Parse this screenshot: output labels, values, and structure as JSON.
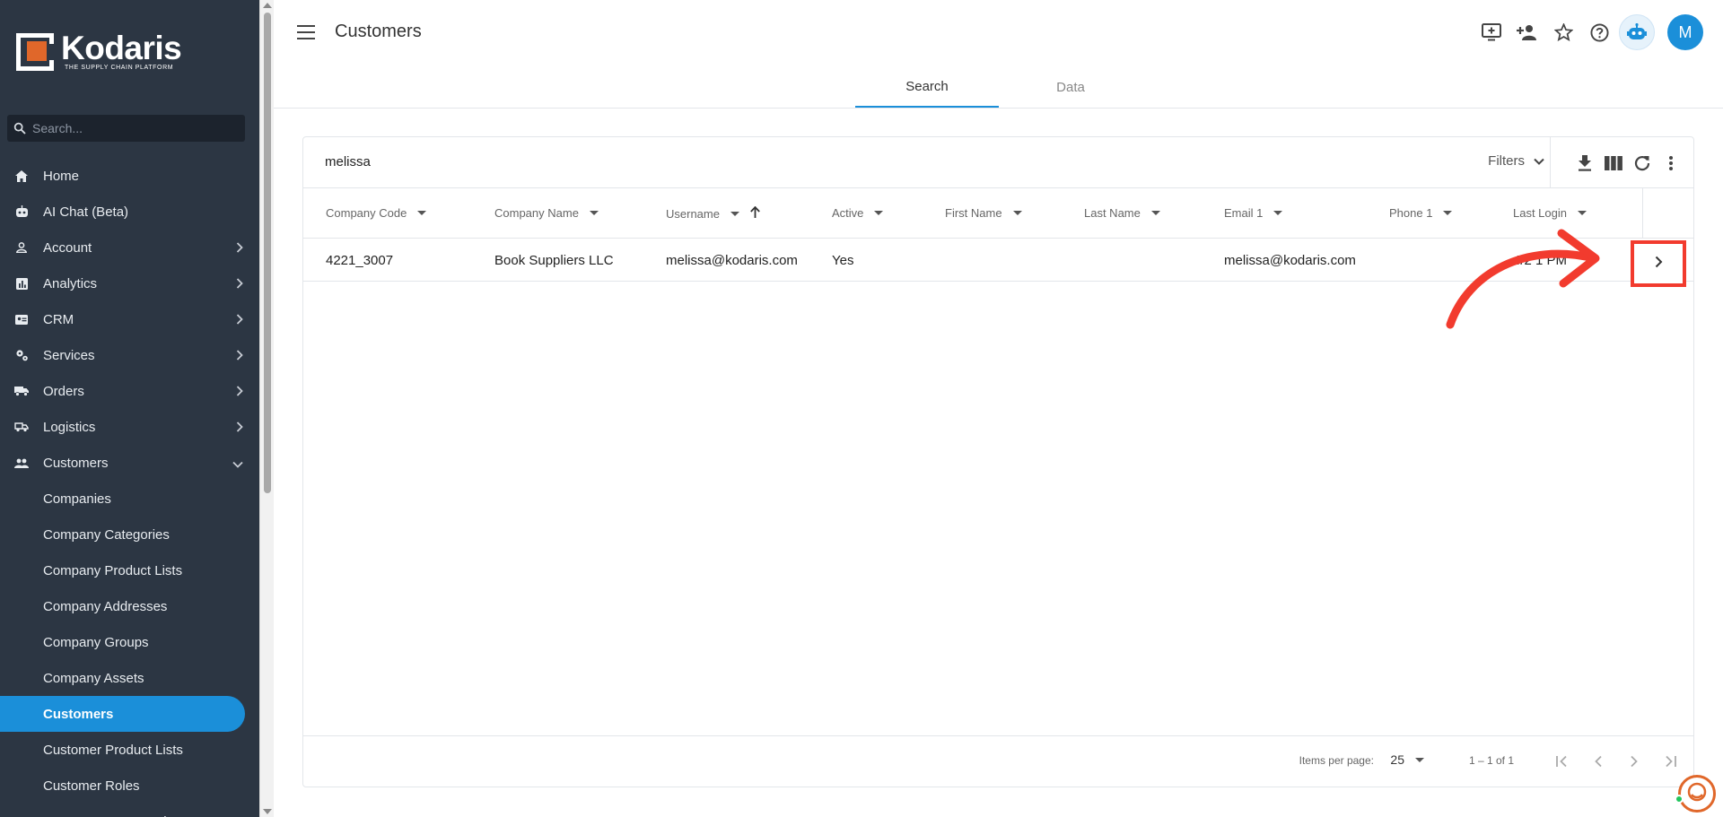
{
  "brand": {
    "name": "Kodaris",
    "tagline": "THE SUPPLY CHAIN PLATFORM",
    "accent": "#1b8fd9",
    "logo_orange": "#e0672a"
  },
  "sidebar": {
    "search_placeholder": "Search...",
    "items": [
      {
        "label": "Home",
        "icon": "home-icon",
        "chevron": false
      },
      {
        "label": "AI Chat (Beta)",
        "icon": "robot-icon",
        "chevron": false
      },
      {
        "label": "Account",
        "icon": "person-icon",
        "chevron": true
      },
      {
        "label": "Analytics",
        "icon": "chart-icon",
        "chevron": true
      },
      {
        "label": "CRM",
        "icon": "contact-card-icon",
        "chevron": true
      },
      {
        "label": "Services",
        "icon": "gears-icon",
        "chevron": true
      },
      {
        "label": "Orders",
        "icon": "truck-icon",
        "chevron": true
      },
      {
        "label": "Logistics",
        "icon": "delivery-icon",
        "chevron": true
      },
      {
        "label": "Customers",
        "icon": "people-icon",
        "chevron": true,
        "expanded": true
      }
    ],
    "sub_items": [
      "Companies",
      "Company Categories",
      "Company Product Lists",
      "Company Addresses",
      "Company Groups",
      "Company Assets",
      "Customers",
      "Customer Product Lists",
      "Customer Roles",
      "Customer Group Rules"
    ],
    "active_sub": "Customers"
  },
  "header": {
    "title": "Customers",
    "tabs": [
      {
        "label": "Search",
        "active": true
      },
      {
        "label": "Data",
        "active": false
      }
    ],
    "icons": [
      "add-screen-icon",
      "add-person-icon",
      "star-icon",
      "help-icon",
      "robot-icon"
    ],
    "avatar_letter": "M"
  },
  "table": {
    "search_value": "melissa",
    "filters_label": "Filters",
    "toolbar_icons": [
      "download-icon",
      "columns-icon",
      "refresh-icon",
      "more-vert-icon"
    ],
    "columns": [
      "Company Code",
      "Company Name",
      "Username",
      "Active",
      "First Name",
      "Last Name",
      "Email 1",
      "Phone 1",
      "Last Login"
    ],
    "rows": [
      {
        "company_code": "4221_3007",
        "company_name": "Book Suppliers LLC",
        "username": "melissa@kodaris.com",
        "active": "Yes",
        "first_name": "",
        "last_name": "",
        "email": "melissa@kodaris.com",
        "phone": "",
        "last_login": "4/2 1 PM"
      }
    ],
    "footer": {
      "items_per_page_label": "Items per page:",
      "items_per_page": "25",
      "range": "1 – 1 of 1"
    }
  },
  "annotation": {
    "color": "#f23b2e"
  }
}
